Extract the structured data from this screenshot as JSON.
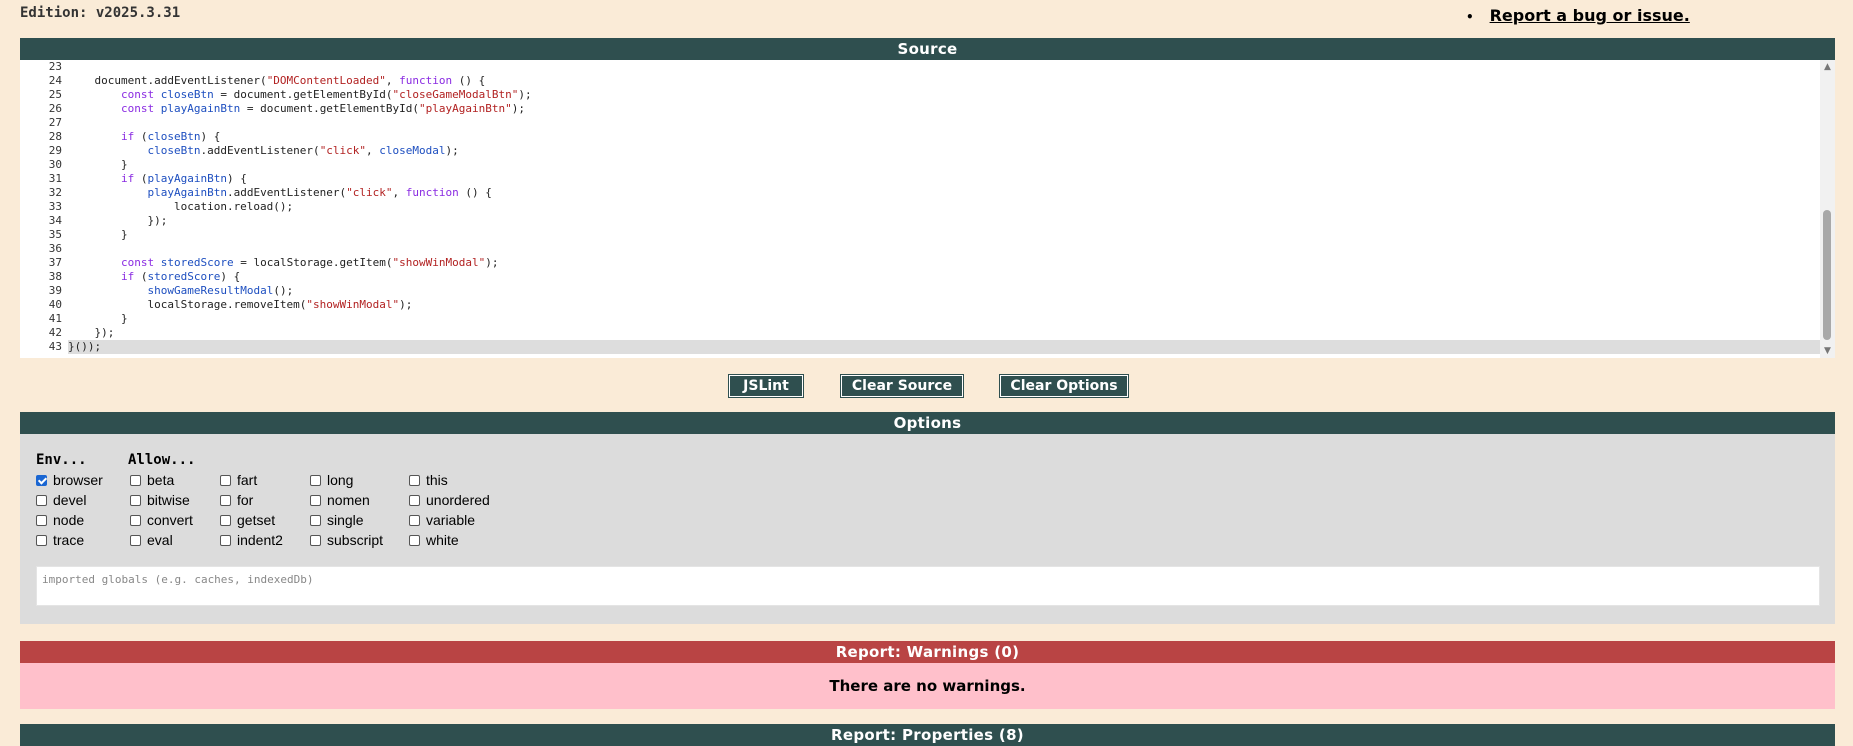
{
  "edition": "Edition: v2025.3.31",
  "report_link": "Report a bug or issue.",
  "source": {
    "header": "Source",
    "lines": [
      {
        "n": "23",
        "t": ""
      },
      {
        "n": "24",
        "t": "    document.addEventListener(\"DOMContentLoaded\", function () {"
      },
      {
        "n": "25",
        "t": "        const closeBtn = document.getElementById(\"closeGameModalBtn\");"
      },
      {
        "n": "26",
        "t": "        const playAgainBtn = document.getElementById(\"playAgainBtn\");"
      },
      {
        "n": "27",
        "t": ""
      },
      {
        "n": "28",
        "t": "        if (closeBtn) {"
      },
      {
        "n": "29",
        "t": "            closeBtn.addEventListener(\"click\", closeModal);"
      },
      {
        "n": "30",
        "t": "        }"
      },
      {
        "n": "31",
        "t": "        if (playAgainBtn) {"
      },
      {
        "n": "32",
        "t": "            playAgainBtn.addEventListener(\"click\", function () {"
      },
      {
        "n": "33",
        "t": "                location.reload();"
      },
      {
        "n": "34",
        "t": "            });"
      },
      {
        "n": "35",
        "t": "        }"
      },
      {
        "n": "36",
        "t": ""
      },
      {
        "n": "37",
        "t": "        const storedScore = localStorage.getItem(\"showWinModal\");"
      },
      {
        "n": "38",
        "t": "        if (storedScore) {"
      },
      {
        "n": "39",
        "t": "            showGameResultModal();"
      },
      {
        "n": "40",
        "t": "            localStorage.removeItem(\"showWinModal\");"
      },
      {
        "n": "41",
        "t": "        }"
      },
      {
        "n": "42",
        "t": "    });"
      },
      {
        "n": "43",
        "t": "}());"
      }
    ],
    "highlighted_line": "43"
  },
  "buttons": {
    "jslint": "JSLint",
    "clear_source": "Clear Source",
    "clear_options": "Clear Options"
  },
  "options": {
    "header": "Options",
    "env_heading": "Env...",
    "allow_heading": "Allow...",
    "env": [
      {
        "label": "browser",
        "checked": true
      },
      {
        "label": "devel",
        "checked": false
      },
      {
        "label": "node",
        "checked": false
      },
      {
        "label": "trace",
        "checked": false
      }
    ],
    "allow_col1": [
      {
        "label": "beta",
        "checked": false
      },
      {
        "label": "bitwise",
        "checked": false
      },
      {
        "label": "convert",
        "checked": false
      },
      {
        "label": "eval",
        "checked": false
      }
    ],
    "allow_col2": [
      {
        "label": "fart",
        "checked": false
      },
      {
        "label": "for",
        "checked": false
      },
      {
        "label": "getset",
        "checked": false
      },
      {
        "label": "indent2",
        "checked": false
      }
    ],
    "allow_col3": [
      {
        "label": "long",
        "checked": false
      },
      {
        "label": "nomen",
        "checked": false
      },
      {
        "label": "single",
        "checked": false
      },
      {
        "label": "subscript",
        "checked": false
      }
    ],
    "allow_col4": [
      {
        "label": "this",
        "checked": false
      },
      {
        "label": "unordered",
        "checked": false
      },
      {
        "label": "variable",
        "checked": false
      },
      {
        "label": "white",
        "checked": false
      }
    ],
    "globals_placeholder": "imported globals (e.g. caches, indexedDb)"
  },
  "warnings": {
    "header": "Report: Warnings (0)",
    "message": "There are no warnings."
  },
  "properties": {
    "header": "Report: Properties (8)"
  },
  "colors": {
    "page_bg": "#faebd7",
    "header_dark": "#2f4f4f",
    "header_red": "#b94444",
    "warning_bg": "#ffc0cb",
    "options_bg": "#dcdcdc"
  }
}
